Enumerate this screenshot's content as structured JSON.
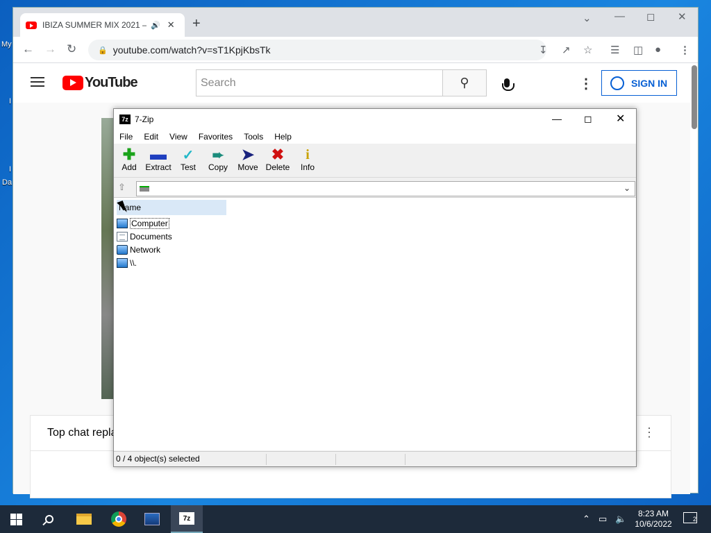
{
  "desktop": {
    "labels": [
      "My",
      "I",
      "I",
      "Da"
    ]
  },
  "chrome": {
    "tab_title": "IBIZA SUMMER MIX 2021 –",
    "url": "youtube.com/watch?v=sT1KpjKbsTk"
  },
  "youtube": {
    "logo_text": "YouTube",
    "search_placeholder": "Search",
    "sign_in": "SIGN IN",
    "chat_title": "Top chat repla"
  },
  "zip": {
    "title": "7-Zip",
    "menu": [
      "File",
      "Edit",
      "View",
      "Favorites",
      "Tools",
      "Help"
    ],
    "toolbar": [
      {
        "label": "Add",
        "icon": "plus-icon",
        "color": "#1aa31a"
      },
      {
        "label": "Extract",
        "icon": "minus-icon",
        "color": "#1f3fbf"
      },
      {
        "label": "Test",
        "icon": "check-icon",
        "color": "#22b8c8"
      },
      {
        "label": "Copy",
        "icon": "double-arrow-icon",
        "color": "#1c8c7c"
      },
      {
        "label": "Move",
        "icon": "arrow-right-icon",
        "color": "#1a237e"
      },
      {
        "label": "Delete",
        "icon": "delete-x-icon",
        "color": "#d01010"
      },
      {
        "label": "Info",
        "icon": "info-icon",
        "color": "#c9a200"
      }
    ],
    "column_name": "Name",
    "items": [
      "Computer",
      "Documents",
      "Network",
      "\\\\."
    ],
    "status": "0 / 4 object(s) selected"
  },
  "taskbar": {
    "time": "8:23 AM",
    "date": "10/6/2022",
    "notifications": "2"
  }
}
